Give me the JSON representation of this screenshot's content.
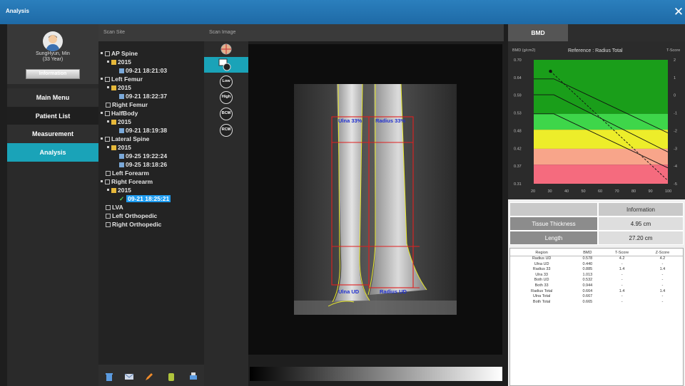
{
  "window": {
    "title": "Analysis"
  },
  "patient": {
    "name": "SungHyun, Min",
    "age": "(33 Year)",
    "info_button": "Information"
  },
  "nav": [
    "Main Menu",
    "Patient List",
    "Measurement",
    "Analysis"
  ],
  "panels": {
    "scan_site": "Scan Site",
    "scan_image": "Scan Image"
  },
  "tree": [
    {
      "label": "AP Spine",
      "level": 0
    },
    {
      "label": "2015",
      "level": 1
    },
    {
      "label": "09-21 18:21:03",
      "level": 2
    },
    {
      "label": "Left Femur",
      "level": 0
    },
    {
      "label": "2015",
      "level": 1
    },
    {
      "label": "09-21 18:22:37",
      "level": 2
    },
    {
      "label": "Right Femur",
      "level": 0
    },
    {
      "label": "HalfBody",
      "level": 0
    },
    {
      "label": "2015",
      "level": 1
    },
    {
      "label": "09-21 18:19:38",
      "level": 2
    },
    {
      "label": "Lateral Spine",
      "level": 0
    },
    {
      "label": "2015",
      "level": 1
    },
    {
      "label": "09-25 19:22:24",
      "level": 2
    },
    {
      "label": "09-25 18:18:26",
      "level": 2
    },
    {
      "label": "Left Forearm",
      "level": 0
    },
    {
      "label": "Right Forearm",
      "level": 0
    },
    {
      "label": "2015",
      "level": 1
    },
    {
      "label": "09-21 18:25:21",
      "level": 2
    },
    {
      "label": "LVA",
      "level": 0
    },
    {
      "label": "Left Orthopedic",
      "level": 0
    },
    {
      "label": "Right Orthopedic",
      "level": 0
    }
  ],
  "tools": [
    "Low",
    "High",
    "BCM",
    "RCM"
  ],
  "roi_labels": {
    "ulna33": "Ulna 33%",
    "radius33": "Radius 33%",
    "ulnaud": "Ulna UD",
    "radiusud": "Radius UD"
  },
  "tab": {
    "bmd": "BMD"
  },
  "chart_data": {
    "type": "line",
    "ylabel": "BMD (g/cm2)",
    "title": "Reference : Radius Total",
    "y2label": "T-Score",
    "x_ticks": [
      "20",
      "30",
      "40",
      "50",
      "60",
      "70",
      "80",
      "90",
      "100"
    ],
    "y_ticks": [
      "0.70",
      "0.64",
      "0.59",
      "0.53",
      "0.48",
      "0.42",
      "0.37",
      "0.31"
    ],
    "y2_ticks": [
      "2",
      "1",
      "0",
      "-1",
      "-2",
      "-3",
      "-4",
      "-5"
    ],
    "xlim": [
      20,
      100
    ],
    "ylim": [
      0.31,
      0.7
    ],
    "bands": [
      {
        "from": 0.53,
        "to": 0.7,
        "color": "#1a9e1a"
      },
      {
        "from": 0.48,
        "to": 0.53,
        "color": "#3ed64a"
      },
      {
        "from": 0.42,
        "to": 0.48,
        "color": "#eded2a"
      },
      {
        "from": 0.37,
        "to": 0.42,
        "color": "#f8a58a"
      },
      {
        "from": 0.31,
        "to": 0.37,
        "color": "#f56b7e"
      }
    ],
    "series": [
      {
        "x": [
          20,
          32,
          100
        ],
        "y": [
          0.64,
          0.64,
          0.47
        ]
      },
      {
        "x": [
          20,
          32,
          100
        ],
        "y": [
          0.59,
          0.59,
          0.41
        ]
      },
      {
        "x": [
          20,
          32,
          100
        ],
        "y": [
          0.53,
          0.53,
          0.36
        ]
      },
      {
        "x": [
          30,
          100
        ],
        "y": [
          0.664,
          0.32
        ],
        "dashed": true
      }
    ],
    "point": {
      "x": 30,
      "y": 0.664
    }
  },
  "info_table": {
    "header": "Information",
    "rows": [
      {
        "label": "Tissue Thickness",
        "value": "4.95 cm"
      },
      {
        "label": "Length",
        "value": "27.20 cm"
      }
    ]
  },
  "region_table": {
    "headers": [
      "Region",
      "BMD",
      "T-Score",
      "Z-Score"
    ],
    "rows": [
      [
        "Radius UD",
        "0.578",
        "4.2",
        "4.2"
      ],
      [
        "Ulna UD",
        "0.440",
        "-",
        "-"
      ],
      [
        "Radius 33",
        "0.885",
        "1.4",
        "1.4"
      ],
      [
        "Ulra 33",
        "1.013",
        "-",
        "-"
      ],
      [
        "Both UD",
        "0.532",
        "-",
        "-"
      ],
      [
        "Both 33",
        "0.944",
        "-",
        "-"
      ],
      [
        "Radius Total",
        "0.664",
        "1.4",
        "1.4"
      ],
      [
        "Ulna Total",
        "0.667",
        "-",
        "-"
      ],
      [
        "Both Total",
        "0.665",
        "-",
        "-"
      ]
    ]
  }
}
